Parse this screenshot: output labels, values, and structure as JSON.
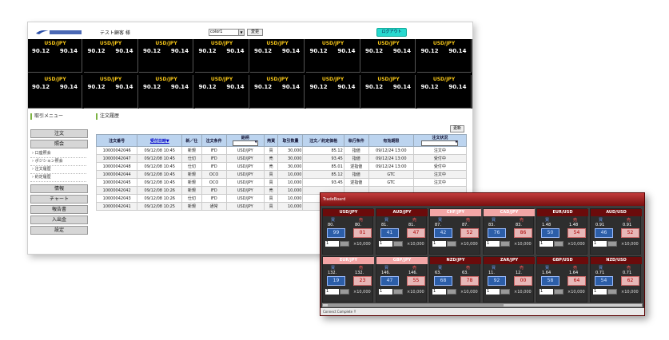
{
  "header": {
    "user_name": "テスト顧客 様",
    "color_select": "color1",
    "change_label": "変更",
    "logout_label": "ログアウト"
  },
  "rate_board": [
    {
      "pair": "USD/JPY",
      "bid": "90.12",
      "ask": "90.14"
    },
    {
      "pair": "USD/JPY",
      "bid": "90.12",
      "ask": "90.14"
    },
    {
      "pair": "USD/JPY",
      "bid": "90.12",
      "ask": "90.14"
    },
    {
      "pair": "USD/JPY",
      "bid": "90.12",
      "ask": "90.14"
    },
    {
      "pair": "USD/JPY",
      "bid": "90.12",
      "ask": "90.14"
    },
    {
      "pair": "USD/JPY",
      "bid": "90.12",
      "ask": "90.14"
    },
    {
      "pair": "USD/JPY",
      "bid": "90.12",
      "ask": "90.14"
    },
    {
      "pair": "USD/JPY",
      "bid": "90.12",
      "ask": "90.14"
    },
    {
      "pair": "USD/JPY",
      "bid": "90.12",
      "ask": "90.14"
    },
    {
      "pair": "USD/JPY",
      "bid": "90.12",
      "ask": "90.14"
    },
    {
      "pair": "USD/JPY",
      "bid": "90.12",
      "ask": "90.14"
    },
    {
      "pair": "USD/JPY",
      "bid": "90.12",
      "ask": "90.14"
    },
    {
      "pair": "USD/JPY",
      "bid": "90.12",
      "ask": "90.14"
    },
    {
      "pair": "USD/JPY",
      "bid": "90.12",
      "ask": "90.14"
    },
    {
      "pair": "USD/JPY",
      "bid": "90.12",
      "ask": "90.14"
    },
    {
      "pair": "USD/JPY",
      "bid": "90.12",
      "ask": "90.14"
    }
  ],
  "sidebar": {
    "title": "取引メニュー",
    "items": [
      "注文",
      "照会",
      "口座照会",
      "ポジション照会",
      "注文履歴",
      "約定履歴",
      "情報",
      "チャート",
      "報告書",
      "入出金",
      "設定"
    ]
  },
  "main": {
    "title": "注文履歴",
    "refresh_label": "更新",
    "columns": [
      "注文番号",
      "受付日時▼",
      "新／仕",
      "注文条件",
      "銘柄",
      "売買",
      "取引数量",
      "注文／約定価格",
      "執行条件",
      "有効期限",
      "注文状況"
    ],
    "rows": [
      [
        "10000042046",
        "09/12/08 10:45",
        "新規",
        "IFD",
        "USD/JPY",
        "買",
        "30,000",
        "85.12",
        "指値",
        "09/12/24 13:00",
        "注文中"
      ],
      [
        "10000042047",
        "09/12/08 10:45",
        "仕切",
        "IFD",
        "USD/JPY",
        "売",
        "30,000",
        "93.45",
        "指値",
        "09/12/24 13:00",
        "受付中"
      ],
      [
        "10000042048",
        "09/12/08 10:45",
        "仕切",
        "IFD",
        "USD/JPY",
        "売",
        "30,000",
        "85.01",
        "逆指値",
        "09/12/24 13:00",
        "受付中"
      ],
      [
        "10000042044",
        "09/12/08 10:45",
        "新規",
        "OCO",
        "USD/JPY",
        "買",
        "10,000",
        "85.12",
        "指値",
        "GTC",
        "注文中"
      ],
      [
        "10000042045",
        "09/12/08 10:45",
        "新規",
        "OCO",
        "USD/JPY",
        "買",
        "10,000",
        "93.45",
        "逆指値",
        "GTC",
        "注文中"
      ],
      [
        "10000042042",
        "09/12/08 10:26",
        "新規",
        "IFD",
        "USD/JPY",
        "売",
        "10,000",
        "",
        "",
        "",
        ""
      ],
      [
        "10000042043",
        "09/12/08 10:26",
        "仕切",
        "IFD",
        "USD/JPY",
        "買",
        "10,000",
        "",
        "",
        "",
        ""
      ],
      [
        "10000042041",
        "09/12/08 10:25",
        "新規",
        "通常",
        "USD/JPY",
        "買",
        "10,000",
        "",
        "",
        "",
        ""
      ]
    ]
  },
  "dashboard": {
    "title": "TradeBoard",
    "buy_label": "買",
    "sell_label": "売",
    "status": "Connect Complete !!",
    "cells": [
      {
        "pair": "USD/JPY",
        "bid_big": "80.",
        "ask_big": "80.",
        "bid": "99",
        "ask": "01",
        "qty": "1",
        "unit": "×10,000",
        "style": "dark"
      },
      {
        "pair": "AUD/JPY",
        "bid_big": "81.",
        "ask_big": "81.",
        "bid": "41",
        "ask": "47",
        "qty": "1",
        "unit": "×10,000",
        "style": "dark"
      },
      {
        "pair": "CHF/JPY",
        "bid_big": "87.",
        "ask_big": "87.",
        "bid": "42",
        "ask": "52",
        "qty": "1",
        "unit": "×10,000",
        "style": "pink"
      },
      {
        "pair": "CAD/JPY",
        "bid_big": "83.",
        "ask_big": "83.",
        "bid": "76",
        "ask": "86",
        "qty": "1",
        "unit": "×10,000",
        "style": "pink"
      },
      {
        "pair": "EUR/USD",
        "bid_big": "1.48",
        "ask_big": "1.48",
        "bid": "50",
        "ask": "54",
        "qty": "1",
        "unit": "×10,000",
        "style": "dark"
      },
      {
        "pair": "AUD/USD",
        "bid_big": "0.91",
        "ask_big": "0.91",
        "bid": "46",
        "ask": "52",
        "qty": "1",
        "unit": "×10,000",
        "style": "dark"
      },
      {
        "pair": "EUR/JPY",
        "bid_big": "132.",
        "ask_big": "132.",
        "bid": "19",
        "ask": "23",
        "qty": "1",
        "unit": "×10,000",
        "style": "pink"
      },
      {
        "pair": "GBP/JPY",
        "bid_big": "146.",
        "ask_big": "146.",
        "bid": "47",
        "ask": "55",
        "qty": "1",
        "unit": "×10,000",
        "style": "pink"
      },
      {
        "pair": "NZD/JPY",
        "bid_big": "63.",
        "ask_big": "63.",
        "bid": "68",
        "ask": "78",
        "qty": "1",
        "unit": "×10,000",
        "style": "dark"
      },
      {
        "pair": "ZAR/JPY",
        "bid_big": "11.",
        "ask_big": "12.",
        "bid": "92",
        "ask": "00",
        "qty": "1",
        "unit": "×10,000",
        "style": "dark"
      },
      {
        "pair": "GBP/USD",
        "bid_big": "1.64",
        "ask_big": "1.64",
        "bid": "58",
        "ask": "64",
        "qty": "1",
        "unit": "×10,000",
        "style": "dark"
      },
      {
        "pair": "NZD/USD",
        "bid_big": "0.71",
        "ask_big": "0.71",
        "bid": "54",
        "ask": "62",
        "qty": "1",
        "unit": "×10,000",
        "style": "dark"
      }
    ]
  },
  "colors": {
    "board_bg": "#000000",
    "pair_yellow": "#f5c518",
    "titlebar_red": "#c23a3a",
    "logout_cyan": "#29d9cf",
    "table_header": "#bcd4ef"
  }
}
